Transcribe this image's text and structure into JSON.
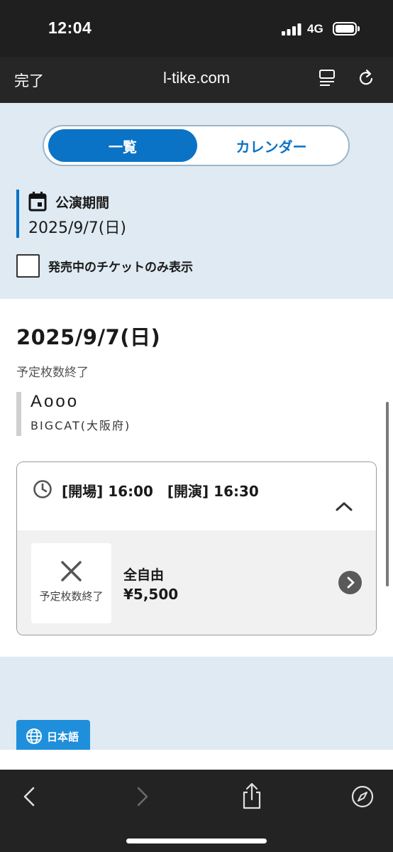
{
  "status_bar": {
    "time": "12:04",
    "network": "4G"
  },
  "browser": {
    "done_label": "完了",
    "domain": "l-tike.com"
  },
  "view_toggle": {
    "list_label": "一覧",
    "calendar_label": "カレンダー",
    "active": "list"
  },
  "period": {
    "label": "公演期間",
    "date": "2025/9/7(日)"
  },
  "filter": {
    "on_sale_only_label": "発売中のチケットのみ表示",
    "checked": false
  },
  "listing": {
    "date_heading": "2025/9/7(日)",
    "status_note": "予定枚数終了",
    "event": {
      "name": "Aooo",
      "venue": "BIGCAT(大阪府)"
    },
    "performance": {
      "time_text": "[開場] 16:00　[開演] 16:30",
      "tickets": [
        {
          "status": "予定枚数終了",
          "seat_type": "全自由",
          "price": "¥5,500"
        }
      ]
    }
  },
  "language_button": {
    "label": "日本語"
  },
  "colors": {
    "accent": "#0a73c6",
    "panel_bg": "#dfeaf2",
    "chrome": "#232323"
  },
  "icons": [
    "signal-icon",
    "battery-icon",
    "reader-icon",
    "reload-icon",
    "calendar-icon",
    "clock-icon",
    "chevron-up-icon",
    "close-x-icon",
    "chevron-right-icon",
    "globe-icon",
    "back-icon",
    "forward-icon",
    "share-icon",
    "compass-icon"
  ]
}
